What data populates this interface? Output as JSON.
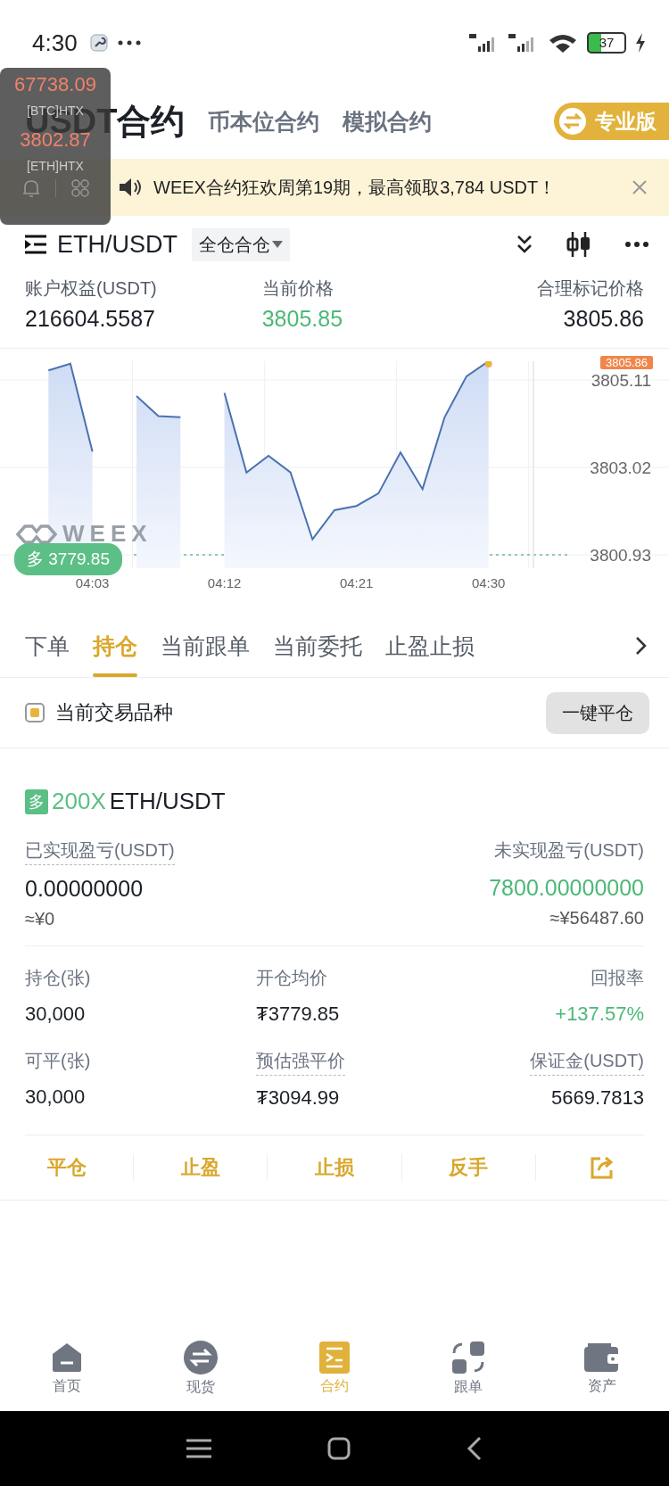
{
  "status_bar": {
    "time": "4:30",
    "battery": "37"
  },
  "floating_ticker": {
    "items": [
      {
        "price": "67738.09",
        "pair": "[BTC]HTX"
      },
      {
        "price": "3802.87",
        "pair": "[ETH]HTX"
      }
    ]
  },
  "header": {
    "tabs": [
      {
        "label": "USDT合约",
        "selected": true
      },
      {
        "label": "币本位合约",
        "selected": false
      },
      {
        "label": "模拟合约",
        "selected": false
      }
    ],
    "pro_button": "专业版"
  },
  "banner": {
    "text": "WEEX合约狂欢周第19期，最高领取3,784 USDT！"
  },
  "pair": {
    "symbol": "ETH/USDT",
    "margin_mode": "全仓合仓"
  },
  "stats": [
    {
      "label": "账户权益(USDT)",
      "value": "216604.5587"
    },
    {
      "label": "当前价格",
      "value": "3805.85",
      "kind": "up"
    },
    {
      "label": "合理标记价格",
      "value": "3805.86"
    }
  ],
  "chart": {
    "watermark": "WEEX",
    "last_price": "3805.86",
    "position_tag": {
      "side": "多",
      "price": "3779.85"
    },
    "chart_data": {
      "type": "area",
      "grid": true,
      "categories": [
        null,
        null,
        null,
        null,
        "04:03",
        null,
        null,
        null,
        null,
        null,
        "04:12",
        null,
        null,
        null,
        null,
        null,
        "04:21",
        null,
        null,
        null,
        null,
        null,
        "04:30"
      ],
      "series": [
        {
          "color": "#4a72b0",
          "values": [
            null,
            null,
            3805.34,
            3805.5,
            3803.4,
            null,
            3804.73,
            3804.25,
            3804.22,
            null,
            3804.8,
            3802.9,
            3803.3,
            3802.9,
            3801.3,
            3802.0,
            3802.1,
            3802.4,
            3803.38,
            3802.5,
            3804.22,
            3805.2,
            3805.56
          ]
        }
      ],
      "ylim": [
        3800.61,
        3805.56
      ],
      "ref_lines": [
        {
          "value": 3800.93,
          "axis": "y",
          "color": "#6cbf8c"
        }
      ],
      "yticks": [
        3805.11,
        3803.02,
        3800.93
      ]
    }
  },
  "tabs": [
    {
      "label": "下单",
      "selected": false
    },
    {
      "label": "持仓",
      "selected": true
    },
    {
      "label": "当前跟单",
      "selected": false
    },
    {
      "label": "当前委托",
      "selected": false
    },
    {
      "label": "止盈止损",
      "selected": false
    }
  ],
  "filter": {
    "label": "当前交易品种",
    "checked": true,
    "close_all_button": "一键平仓"
  },
  "position": {
    "side": "多",
    "leverage": "200X",
    "symbol": "ETH/USDT",
    "realized": {
      "label": "已实现盈亏(USDT)",
      "value": "0.00000000",
      "fiat": "≈¥0",
      "dotted": true
    },
    "unrealized": {
      "label": "未实现盈亏(USDT)",
      "value": "7800.00000000",
      "fiat": "≈¥56487.60",
      "kind": "up",
      "dotted": false
    },
    "fields": [
      {
        "label": "持仓(张)",
        "value": "30,000",
        "dotted": false
      },
      {
        "label": "开仓均价",
        "value": "₮3779.85",
        "dotted": false
      },
      {
        "label": "回报率",
        "value": "+137.57%",
        "kind": "up",
        "dotted": false
      },
      {
        "label": "可平(张)",
        "value": "30,000",
        "dotted": false
      },
      {
        "label": "预估强平价",
        "value": "₮3094.99",
        "dotted": true
      },
      {
        "label": "保证金(USDT)",
        "value": "5669.7813",
        "dotted": true
      }
    ],
    "actions": [
      "平仓",
      "止盈",
      "止损",
      "反手"
    ]
  },
  "bottom_nav": [
    {
      "label": "首页",
      "selected": false
    },
    {
      "label": "现货",
      "selected": false
    },
    {
      "label": "合约",
      "selected": true
    },
    {
      "label": "跟单",
      "selected": false
    },
    {
      "label": "资产",
      "selected": false
    }
  ]
}
